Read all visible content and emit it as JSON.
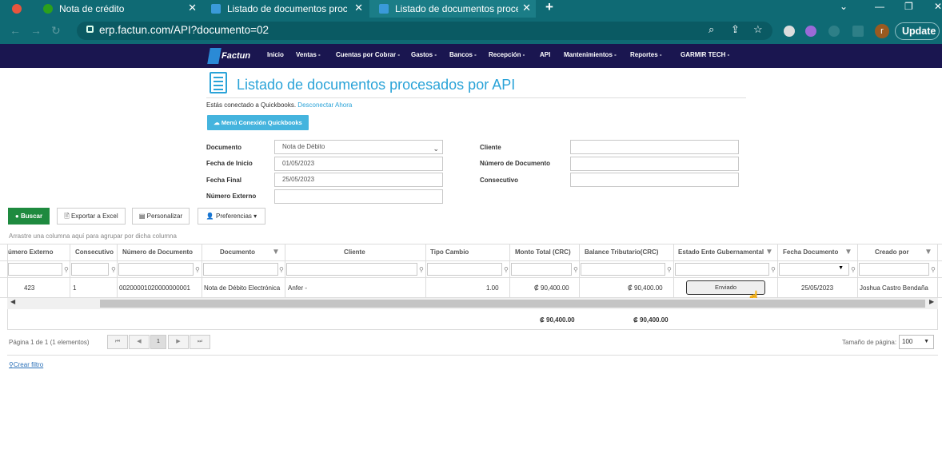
{
  "browser": {
    "tabs": [
      {
        "title": "Nota de crédito",
        "active": false
      },
      {
        "title": "Listado de documentos procesados",
        "active": false
      },
      {
        "title": "Listado de documentos procesados",
        "active": true
      }
    ],
    "new_tab": "+",
    "url": "erp.factun.com/API?documento=02",
    "profile_initial": "r",
    "update_label": "Update"
  },
  "appnav": {
    "logo_text": "Factun",
    "items": [
      "Inicio",
      "Ventas -",
      "Cuentas por Cobrar -",
      "Gastos -",
      "Bancos -",
      "Recepción -",
      "API",
      "Mantenimientos -",
      "Reportes -",
      "GARMIR TECH -"
    ]
  },
  "page": {
    "title": "Listado de documentos procesados por API",
    "qb_status": "Estás conectado a Quickbooks.",
    "qb_disconnect": "Desconectar Ahora",
    "qb_button": "Menú Conexión Quickbooks"
  },
  "form": {
    "documento_label": "Documento",
    "documento_value": "Nota de Débito",
    "fecha_inicio_label": "Fecha de Inicio",
    "fecha_inicio_value": "01/05/2023",
    "fecha_final_label": "Fecha Final",
    "fecha_final_value": "25/05/2023",
    "numero_externo_label": "Número Externo",
    "cliente_label": "Cliente",
    "numero_documento_label": "Número de Documento",
    "consecutivo_label": "Consecutivo"
  },
  "toolbar": {
    "buscar": "Buscar",
    "exportar": "Exportar a Excel",
    "personalizar": "Personalizar",
    "preferencias": "Preferencias"
  },
  "grid": {
    "group_hint": "Arrastre una columna aquí para agrupar por dicha columna",
    "headers": [
      "úmero Externo",
      "Consecutivo",
      "Número de Documento",
      "Documento",
      "Cliente",
      "Tipo Cambio",
      "Monto Total (CRC)",
      "Balance Tributario(CRC)",
      "Estado Ente Gubernamental",
      "Fecha Documento",
      "Creado por"
    ],
    "row": {
      "numero_externo": "423",
      "consecutivo": "1",
      "numero_documento": "00200001020000000001",
      "documento": "Nota de Débito Electrónica",
      "cliente": "Anfer -",
      "tipo_cambio": "1.00",
      "monto_total": "₡ 90,400.00",
      "balance_tributario": "₡ 90,400.00",
      "estado": "Enviado",
      "fecha_documento": "25/05/2023",
      "creado_por": "Joshua Castro Bendaña"
    },
    "totals": {
      "monto_total": "₡ 90,400.00",
      "balance_tributario": "₡ 90,400.00"
    }
  },
  "pager": {
    "info": "Página 1 de 1 (1 elementos)",
    "current_page": "1",
    "page_size_label": "Tamaño de página:",
    "page_size": "100"
  },
  "create_filter": "Crear filtro"
}
